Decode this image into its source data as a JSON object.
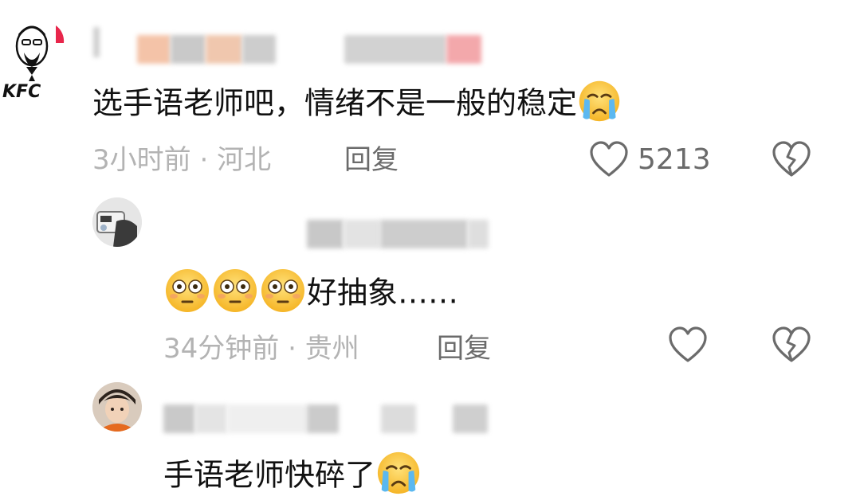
{
  "comments": [
    {
      "avatar_text": "KFC",
      "text": "选手语老师吧，情绪不是一般的稳定",
      "emoji_suffix": "crying-emoji",
      "time": "3小时前",
      "location": "河北",
      "reply_label": "回复",
      "like_count": "5213"
    },
    {
      "text_suffix": "好抽象……",
      "emoji_prefix": [
        "flushed-emoji",
        "flushed-emoji",
        "flushed-emoji"
      ],
      "time": "34分钟前",
      "location": "贵州",
      "reply_label": "回复"
    },
    {
      "text": "手语老师快碎了",
      "emoji_suffix": "crying-emoji"
    }
  ],
  "meta_separator": "·",
  "colors": {
    "text": "#111111",
    "meta_gray": "#b3b3b3",
    "action_gray": "#6b6b6b",
    "kfc_red": "#e4002b",
    "emoji_yellow": "#f7c23a"
  }
}
